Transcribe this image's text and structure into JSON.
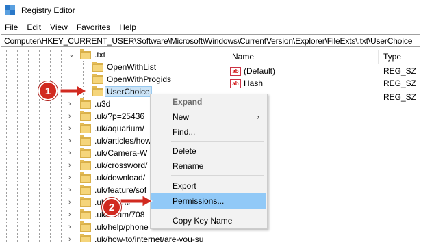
{
  "window": {
    "title": "Registry Editor"
  },
  "menu": [
    "File",
    "Edit",
    "View",
    "Favorites",
    "Help"
  ],
  "address": "Computer\\HKEY_CURRENT_USER\\Software\\Microsoft\\Windows\\CurrentVersion\\Explorer\\FileExts\\.txt\\UserChoice",
  "tree": {
    "parent": ".txt",
    "children": [
      "OpenWithList",
      "OpenWithProgids",
      "UserChoice"
    ],
    "siblings": [
      ".u3d",
      ".uk/?p=25436",
      ".uk/aquarium/",
      ".uk/articles/how",
      ".uk/Camera-W",
      ".uk/crossword/",
      ".uk/download/",
      ".uk/feature/sof",
      ".uk/forum/",
      ".uk/forum/708",
      ".uk/help/phone",
      ".uk/how-to/internet/are-you-su"
    ]
  },
  "values": {
    "headers": {
      "name": "Name",
      "type": "Type"
    },
    "rows": [
      {
        "name": "(Default)",
        "type": "REG_SZ"
      },
      {
        "name": "Hash",
        "type": "REG_SZ"
      },
      {
        "name": "",
        "type": "REG_SZ"
      }
    ]
  },
  "context_menu": {
    "items": [
      "Expand",
      "New",
      "Find...",
      "Delete",
      "Rename",
      "Export",
      "Permissions...",
      "Copy Key Name"
    ],
    "highlighted": "Permissions..."
  },
  "annotations": {
    "badge1": "1",
    "badge2": "2"
  },
  "colors": {
    "highlight": "#91c9f7",
    "selected": "#cce4f7",
    "badge": "#d12a20",
    "folder": "#f5d57b"
  }
}
